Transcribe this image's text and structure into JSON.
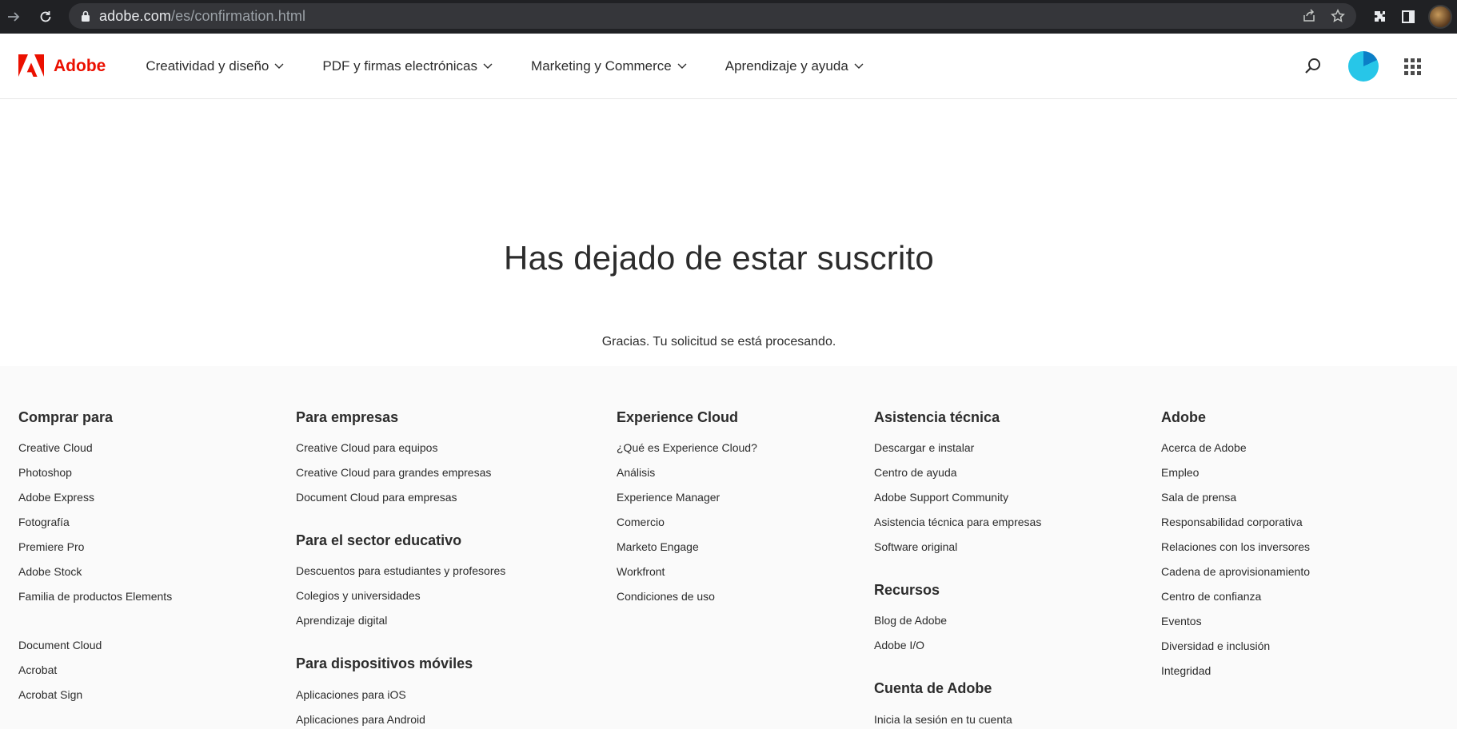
{
  "browser": {
    "url_domain": "adobe.com",
    "url_path": "/es/confirmation.html"
  },
  "header": {
    "brand": "Adobe",
    "nav": [
      "Creatividad y diseño",
      "PDF y firmas electrónicas",
      "Marketing y Commerce",
      "Aprendizaje y ayuda"
    ]
  },
  "main": {
    "title": "Has dejado de estar suscrito",
    "message": "Gracias. Tu solicitud se está procesando."
  },
  "footer": {
    "comprar": {
      "heading": "Comprar para",
      "links": [
        "Creative Cloud",
        "Photoshop",
        "Adobe Express",
        "Fotografía",
        "Premiere Pro",
        "Adobe Stock",
        "Familia de productos Elements"
      ],
      "links2": [
        "Document Cloud",
        "Acrobat",
        "Acrobat Sign"
      ]
    },
    "empresas": {
      "heading": "Para empresas",
      "links": [
        "Creative Cloud para equipos",
        "Creative Cloud para grandes empresas",
        "Document Cloud para empresas"
      ],
      "educativo_heading": "Para el sector educativo",
      "educativo_links": [
        "Descuentos para estudiantes y profesores",
        "Colegios y universidades",
        "Aprendizaje digital"
      ],
      "moviles_heading": "Para dispositivos móviles",
      "moviles_links": [
        "Aplicaciones para iOS",
        "Aplicaciones para Android"
      ]
    },
    "experience": {
      "heading": "Experience Cloud",
      "links": [
        "¿Qué es Experience Cloud?",
        "Análisis",
        "Experience Manager",
        "Comercio",
        "Marketo Engage",
        "Workfront",
        "Condiciones de uso"
      ]
    },
    "asistencia": {
      "heading": "Asistencia técnica",
      "links": [
        "Descargar e instalar",
        "Centro de ayuda",
        "Adobe Support Community",
        "Asistencia técnica para empresas",
        "Software original"
      ],
      "recursos_heading": "Recursos",
      "recursos_links": [
        "Blog de Adobe",
        "Adobe I/O"
      ],
      "cuenta_heading": "Cuenta de Adobe",
      "cuenta_links": [
        "Inicia la sesión en tu cuenta"
      ]
    },
    "adobe": {
      "heading": "Adobe",
      "links": [
        "Acerca de Adobe",
        "Empleo",
        "Sala de prensa",
        "Responsabilidad corporativa",
        "Relaciones con los inversores",
        "Cadena de aprovisionamiento",
        "Centro de confianza",
        "Eventos",
        "Diversidad e inclusión",
        "Integridad"
      ]
    }
  }
}
